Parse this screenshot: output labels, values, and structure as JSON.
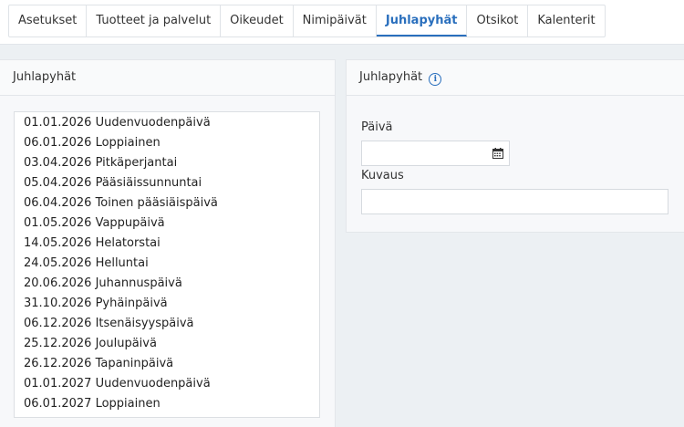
{
  "tabs": [
    {
      "label": "Asetukset",
      "active": false
    },
    {
      "label": "Tuotteet ja palvelut",
      "active": false
    },
    {
      "label": "Oikeudet",
      "active": false
    },
    {
      "label": "Nimipäivät",
      "active": false
    },
    {
      "label": "Juhlapyhät",
      "active": true
    },
    {
      "label": "Otsikot",
      "active": false
    },
    {
      "label": "Kalenterit",
      "active": false
    }
  ],
  "list_panel": {
    "title": "Juhlapyhät",
    "items": [
      "01.01.2026 Uudenvuodenpäivä",
      "06.01.2026 Loppiainen",
      "03.04.2026 Pitkäperjantai",
      "05.04.2026 Pääsiäissunnuntai",
      "06.04.2026 Toinen pääsiäispäivä",
      "01.05.2026 Vappupäivä",
      "14.05.2026 Helatorstai",
      "24.05.2026 Helluntai",
      "20.06.2026 Juhannuspäivä",
      "31.10.2026 Pyhäinpäivä",
      "06.12.2026 Itsenäisyyspäivä",
      "25.12.2026 Joulupäivä",
      "26.12.2026 Tapaninpäivä",
      "01.01.2027 Uudenvuodenpäivä",
      "06.01.2027 Loppiainen"
    ]
  },
  "form_panel": {
    "title": "Juhlapyhät",
    "info_icon": "info-circle-icon",
    "date_label": "Päivä",
    "date_value": "",
    "calendar_icon": "calendar-icon",
    "description_label": "Kuvaus",
    "description_value": ""
  },
  "colors": {
    "accent": "#2a6fbd",
    "background": "#ecf0f3",
    "panel": "#f7f8fa"
  }
}
